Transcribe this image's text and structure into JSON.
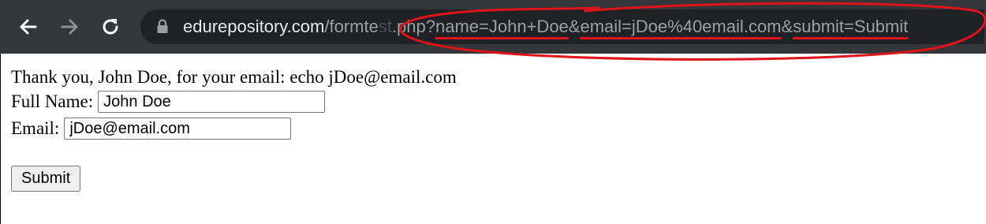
{
  "browser": {
    "nav": {
      "back_icon": "back-arrow-icon",
      "forward_icon": "forward-arrow-icon",
      "reload_icon": "reload-icon"
    },
    "address_bar": {
      "host": "edurepository.com",
      "path_prefix": "/formte",
      "path_hidden": "st",
      "path_mid": ".php?",
      "q_name": "name=John+Doe",
      "amp1": "&",
      "q_email": "email=jDoe%40email.com",
      "amp2": "&",
      "q_submit": "submit=Submit",
      "lock_icon": "lock-icon"
    },
    "colors": {
      "toolbar": "#35363a",
      "omnibox": "#202124",
      "annotation": "#e0121a"
    }
  },
  "page": {
    "thank_you": "Thank you, John Doe, for your email: echo jDoe@email.com",
    "name_label": "Full Name:",
    "name_value": "John Doe",
    "email_label": "Email:",
    "email_value": "jDoe@email.com",
    "submit_label": "Submit"
  }
}
